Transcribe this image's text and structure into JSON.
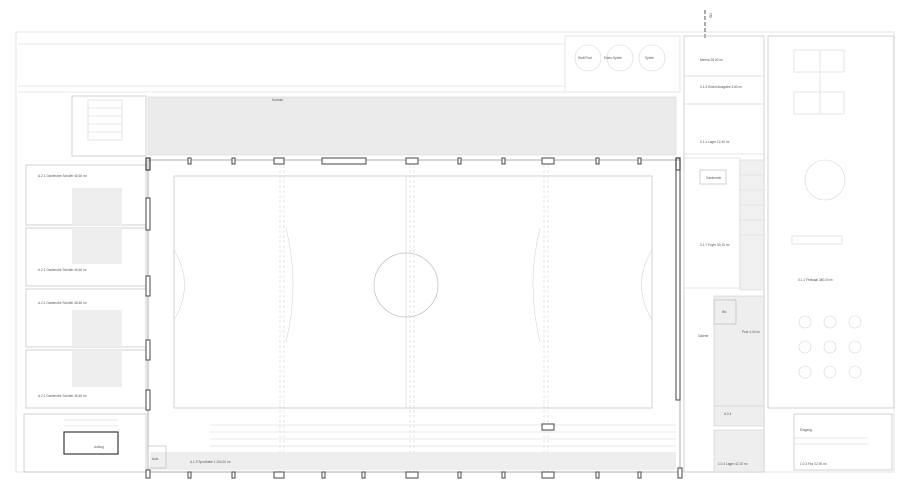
{
  "section_marker": "SD",
  "labels": {
    "corridor": "Korridor",
    "room_top_1": "Stoff-Pool",
    "room_top_2": "Eisen-Spiele",
    "room_top_3": "Spiele",
    "right_1": "Mensa 28,00 m²",
    "right_2": "0.1.3 Küche/Ausgabe 3,60 m²",
    "right_3": "0.1.4 Lager 12,40 m²",
    "right_4": "Garderobe",
    "right_5": "0.1.7 Foyer 30,10 m²",
    "right_6": "Wc",
    "right_7": "Putz 4,40 m²",
    "right_8": "Galerie",
    "right_9": "A.0.4",
    "right_10": "1.0.4 Lager 42,10 m²",
    "far_right_1": "0.1.1 Festsaal 380,00 m²",
    "far_right_2": "Eingang",
    "far_right_3": "1.0.3 Flur 22,90 m²",
    "left_1": "A.2.1 Garderobe Schüler 46,60 m²",
    "left_2": "A.2.1 Garderobe Schüler 46,60 m²",
    "left_3": "A.2.1 Garderobe Schüler 46,60 m²",
    "left_4": "A.2.1 Garderobe Schüler 46,60 m²",
    "hall": "A.1.3 Sporthalle 1.104,00 m²",
    "lift": "Aufzug"
  }
}
